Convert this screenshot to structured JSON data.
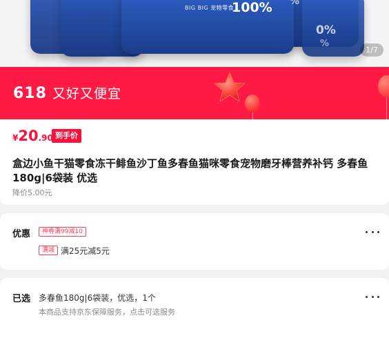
{
  "gallery": {
    "counter": "1/7",
    "pack_brand": "BIG BIG 宠物零食",
    "pack_percent": "100%"
  },
  "banner": {
    "event_number": "618",
    "slogan": "又好又便宜",
    "background_color": "#ff1a43"
  },
  "price": {
    "currency": "¥",
    "integer": "20",
    "decimal": ".90",
    "tag": "到手价",
    "color": "#ff0f3b"
  },
  "product": {
    "title": "盒边小鱼干猫零食冻干鲱鱼沙丁鱼多春鱼猫咪零食宠物磨牙棒营养补钙 多春鱼180g|6袋装 优选",
    "original_price": "降价5.00元"
  },
  "promotions": {
    "label": "优惠",
    "coupon_badge": "神券满99减10",
    "discount_badge": "满减",
    "discount_text": "满25元减5元"
  },
  "selection": {
    "label": "已选",
    "value": "多春鱼180g|6袋装，优选，1个",
    "service_note": "本商品支持京东保障服务，点击可选服务"
  },
  "icons": {
    "more": "more-dots-icon",
    "star": "star-balloon-icon",
    "balloon": "balloon-icon"
  }
}
